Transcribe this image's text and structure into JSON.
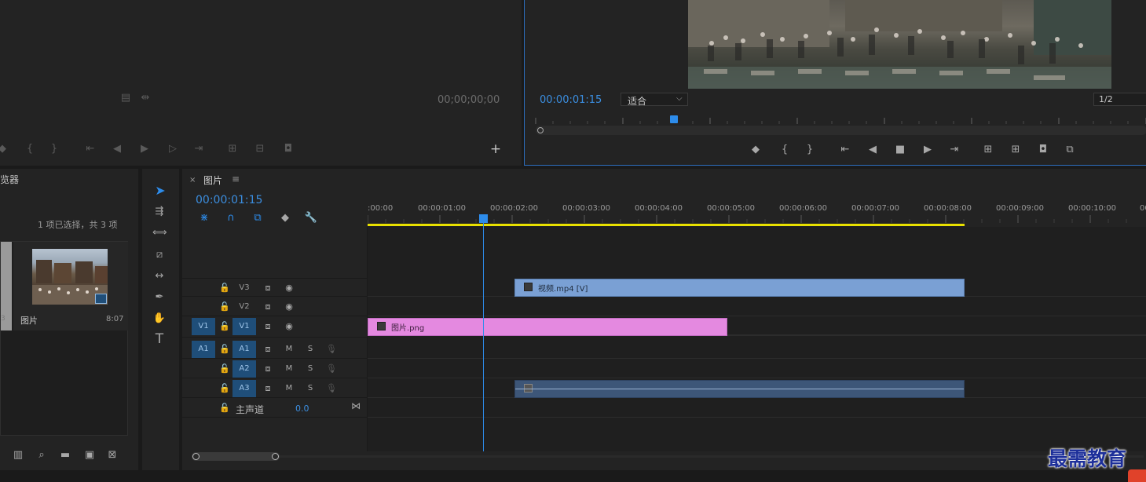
{
  "source_monitor": {
    "timecode": "00;00;00;00"
  },
  "program_monitor": {
    "timecode": "00:00:01:15",
    "zoom": "适合",
    "resolution": "1/2"
  },
  "project_panel": {
    "title_partial": "览器",
    "selection_info": "1 项已选择，共 3 项",
    "item_name": "图片",
    "item_duration": "8:07",
    "left_partial": "3"
  },
  "timeline": {
    "tab_label": "图片",
    "timecode": "00:00:01:15",
    "ruler_labels": [
      ":00:00",
      "00:00:01:00",
      "00:00:02:00",
      "00:00:03:00",
      "00:00:04:00",
      "00:00:05:00",
      "00:00:06:00",
      "00:00:07:00",
      "00:00:08:00",
      "00:00:09:00",
      "00:00:10:00",
      "00:0"
    ],
    "tracks": {
      "V3": "V3",
      "V2": "V2",
      "V1_src": "V1",
      "V1": "V1",
      "A1_src": "A1",
      "A1": "A1",
      "A2": "A2",
      "A3": "A3"
    },
    "mute": "M",
    "solo": "S",
    "master_label": "主声道",
    "master_value": "0.0",
    "clips": {
      "video_clip": "视频.mp4 [V]",
      "image_clip": "图片.png"
    }
  },
  "watermark": "最需教育",
  "colors": {
    "accent_blue": "#2d8ceb",
    "clip_video": "#7aa0d4",
    "clip_image": "#e489e0",
    "clip_audio": "#3d5678",
    "work_area": "#e8e000"
  }
}
